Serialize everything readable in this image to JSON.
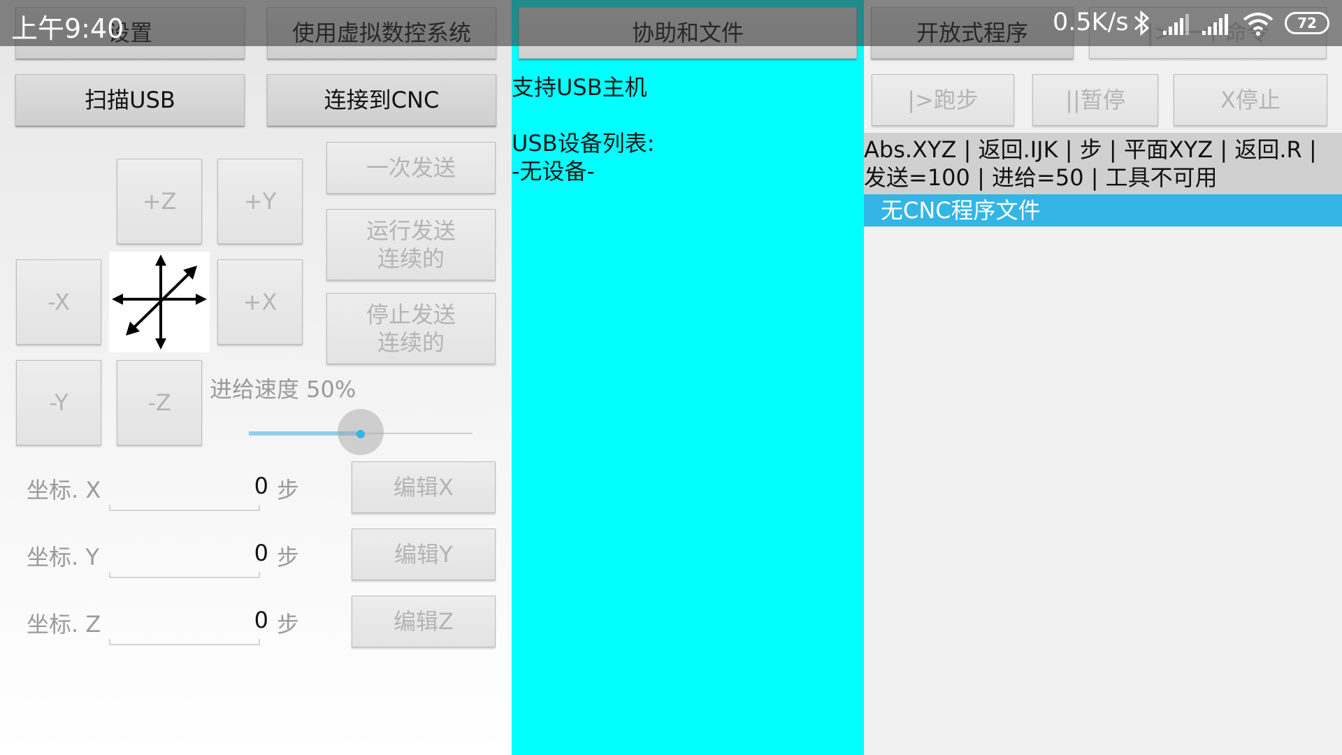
{
  "status_bar": {
    "time": "上午9:40",
    "net_speed": "0.5K/s",
    "battery": "72"
  },
  "tabs": {
    "settings": "设置",
    "virtual_cnc": "使用虚拟数控系统",
    "help_files": "协助和文件",
    "open_program": "开放式程序",
    "one_command": "|> 一个命令"
  },
  "buttons": {
    "scan_usb": "扫描USB",
    "connect_cnc": "连接到CNC",
    "send_once": "一次发送",
    "run_send": [
      "运行发送",
      "连续的"
    ],
    "stop_send": [
      "停止发送",
      "连续的"
    ],
    "run_step": "|>跑步",
    "pause": "||暂停",
    "stop": "X停止"
  },
  "jog": {
    "plus_z": "+Z",
    "plus_y": "+Y",
    "minus_x": "-X",
    "plus_x": "+X",
    "minus_y": "-Y",
    "minus_z": "-Z",
    "center_icon": "four-way-arrow-icon"
  },
  "feed": {
    "label": "进给速度 50%",
    "percent": 50
  },
  "coordinates": [
    {
      "label": "坐标. X",
      "value": "0",
      "unit": "步",
      "edit": "编辑X"
    },
    {
      "label": "坐标. Y",
      "value": "0",
      "unit": "步",
      "edit": "编辑Y"
    },
    {
      "label": "坐标. Z",
      "value": "0",
      "unit": "步",
      "edit": "编辑Z"
    }
  ],
  "usb": {
    "support": "支持USB主机",
    "list_title": "USB设备列表:",
    "no_device": "-无设备-"
  },
  "gcode": {
    "line1": "Abs.XYZ | 返回.IJK | 步 | 平面XYZ | 返回.R |",
    "line2": "发送=100 | 进给=50 | 工具不可用",
    "file": "无CNC程序文件"
  },
  "colors": {
    "middle_bg": "#00ffff",
    "file_bar": "#33b5e5",
    "slider": "#33b5e5"
  }
}
